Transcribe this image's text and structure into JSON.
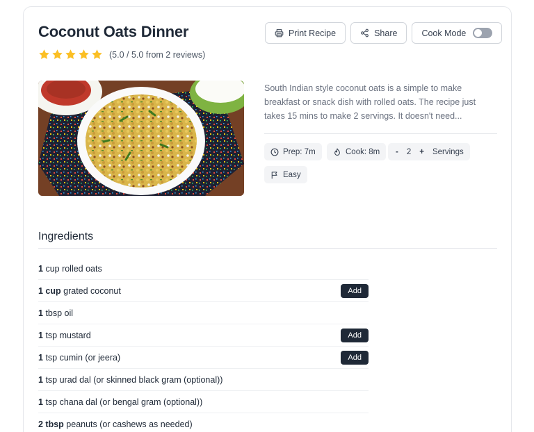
{
  "recipe": {
    "title": "Coconut Oats Dinner",
    "rating_value": 5,
    "rating_text": "(5.0 / 5.0 from 2 reviews)",
    "description": "South Indian style coconut oats is a simple to make breakfast or snack dish with rolled oats. The recipe just takes 15 mins to make 2 servings. It doesn't need..."
  },
  "actions": {
    "print_label": "Print Recipe",
    "share_label": "Share",
    "cook_mode_label": "Cook Mode",
    "cook_mode_on": false
  },
  "meta": {
    "prep": "Prep: 7m",
    "cook": "Cook: 8m",
    "servings_minus": "-",
    "servings_count": "2",
    "servings_plus": "+",
    "servings_label": "Servings",
    "difficulty": "Easy"
  },
  "ingredients": {
    "heading": "Ingredients",
    "add_label": "Add",
    "items": [
      {
        "qty": "1",
        "text": "cup rolled oats",
        "has_add": false
      },
      {
        "qty": "1 cup",
        "text": "grated coconut",
        "has_add": true
      },
      {
        "qty": "1",
        "text": "tbsp oil",
        "has_add": false
      },
      {
        "qty": "1",
        "text": "tsp mustard",
        "has_add": true
      },
      {
        "qty": "1",
        "text": "tsp cumin (or jeera)",
        "has_add": true
      },
      {
        "qty": "1",
        "text": "tsp urad dal (or skinned black gram (optional))",
        "has_add": false
      },
      {
        "qty": "1",
        "text": "tsp chana dal (or bengal gram (optional))",
        "has_add": false
      },
      {
        "qty": "2 tbsp",
        "text": "peanuts (or cashews as needed)",
        "has_add": false
      }
    ]
  },
  "colors": {
    "star": "#fbbf24",
    "add_button": "#1f2937",
    "chip_bg": "#f3f4f6"
  },
  "icons": [
    "star-icon",
    "printer-icon",
    "share-icon",
    "clock-icon",
    "flame-icon",
    "flag-icon"
  ]
}
